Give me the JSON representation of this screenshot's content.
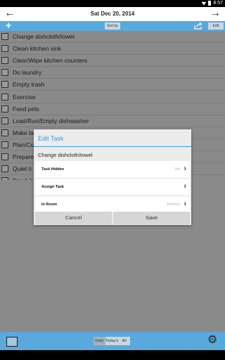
{
  "status_bar": {
    "time": "8:57"
  },
  "date_bar": {
    "date": "Sat Dec 20, 2014",
    "prev": "←",
    "next": "→"
  },
  "toolbar": {
    "add": "+",
    "sort_by": "Sort by",
    "edit": "Edit"
  },
  "tasks": [
    "Change dishcloth/towel",
    "Clean kitchen sink",
    "Clear/Wipe kitchen counters",
    "Do laundry",
    "Empty trash",
    "Exercise",
    "Feed pets",
    "Load/Run/Empty dishwasher",
    "Make beds",
    "Plan/Co",
    "Prepare",
    "Quiet ti",
    "Read Ja",
    "Read to"
  ],
  "dialog": {
    "title": "Edit Task",
    "task_name": "Change dishcloth/towel",
    "options": [
      {
        "label": "Task Hidden",
        "value": "No"
      },
      {
        "label": "Assign Task",
        "value": ""
      },
      {
        "label": "In Room",
        "value": "Kitchen"
      }
    ],
    "cancel": "Cancel",
    "save": "Save"
  },
  "bottom_bar": {
    "tabs": [
      "Daily",
      "Today's",
      "All"
    ],
    "selected_tab": "Daily"
  },
  "colors": {
    "accent": "#5aa9dc",
    "dialog_title": "#3a9ad9",
    "dim_background": "#8a8a8a"
  },
  "icons": [
    "wifi-icon",
    "battery-icon",
    "share-icon",
    "calendar-icon",
    "gear-icon",
    "chevron-right-icon"
  ]
}
